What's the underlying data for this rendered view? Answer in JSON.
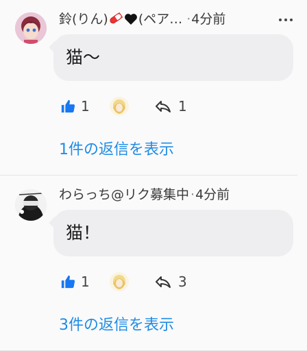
{
  "comments": [
    {
      "username": "鈴(りん)",
      "username_suffix": "(ペア…",
      "time": "4分前",
      "dot": "·",
      "text": "猫〜",
      "likes": "1",
      "replies": "1",
      "view_replies": "1件の返信を表示",
      "badges": [
        "pill-emoji",
        "black-heart-emoji"
      ]
    },
    {
      "username": "わらっち@リク募集中",
      "time": "4分前",
      "dot": "·",
      "text": "猫！",
      "likes": "1",
      "replies": "3",
      "view_replies": "3件の返信を表示"
    }
  ],
  "colors": {
    "accent": "#1f8ce6",
    "like_icon": "#1877f2",
    "bubble": "#eeeef1",
    "background": "#fafafb"
  },
  "icons": [
    "thumbs-up-icon",
    "reply-icon",
    "more-horizontal-icon"
  ]
}
